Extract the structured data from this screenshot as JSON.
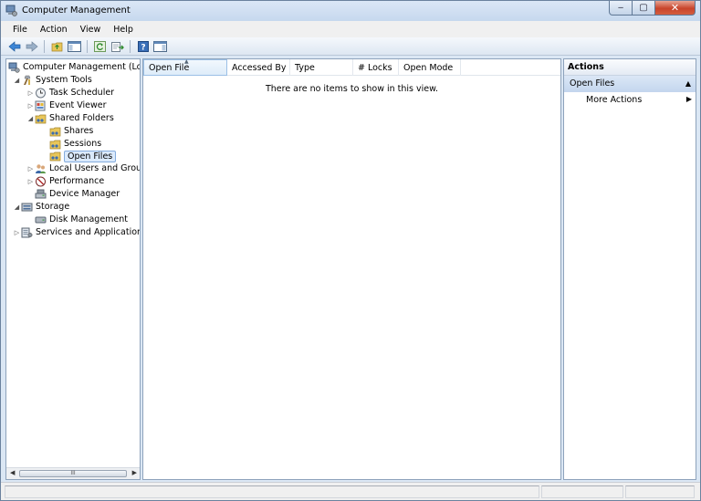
{
  "window": {
    "title": "Computer Management",
    "controls": {
      "minimize": "‒",
      "maximize": "▢",
      "close": "✕"
    }
  },
  "menu": {
    "items": [
      "File",
      "Action",
      "View",
      "Help"
    ]
  },
  "toolbar": {
    "buttons": [
      "back-arrow-icon",
      "forward-arrow-icon",
      "up-folder-icon",
      "show-hide-tree-icon",
      "refresh-icon",
      "export-list-icon",
      "help-icon",
      "show-hide-action-pane-icon"
    ]
  },
  "tree": {
    "items": [
      {
        "label": "Computer Management (Local",
        "level": 0,
        "arrow": "",
        "icon": "computer-management-icon"
      },
      {
        "label": "System Tools",
        "level": 1,
        "arrow": "◢",
        "icon": "system-tools-icon"
      },
      {
        "label": "Task Scheduler",
        "level": 2,
        "arrow": "▷",
        "icon": "clock-icon"
      },
      {
        "label": "Event Viewer",
        "level": 2,
        "arrow": "▷",
        "icon": "event-viewer-icon"
      },
      {
        "label": "Shared Folders",
        "level": 2,
        "arrow": "◢",
        "icon": "shared-folder-icon"
      },
      {
        "label": "Shares",
        "level": 3,
        "arrow": "",
        "icon": "shared-folder-icon"
      },
      {
        "label": "Sessions",
        "level": 3,
        "arrow": "",
        "icon": "shared-folder-icon"
      },
      {
        "label": "Open Files",
        "level": 3,
        "arrow": "",
        "icon": "shared-folder-icon",
        "selected": true
      },
      {
        "label": "Local Users and Groups",
        "level": 2,
        "arrow": "▷",
        "icon": "users-icon"
      },
      {
        "label": "Performance",
        "level": 2,
        "arrow": "▷",
        "icon": "performance-icon"
      },
      {
        "label": "Device Manager",
        "level": 2,
        "arrow": "",
        "icon": "device-manager-icon"
      },
      {
        "label": "Storage",
        "level": 1,
        "arrow": "◢",
        "icon": "storage-icon"
      },
      {
        "label": "Disk Management",
        "level": 2,
        "arrow": "",
        "icon": "disk-icon"
      },
      {
        "label": "Services and Applications",
        "level": 1,
        "arrow": "▷",
        "icon": "services-icon"
      }
    ],
    "scroll_thumb": "III"
  },
  "list": {
    "columns": [
      "Open File",
      "Accessed By",
      "Type",
      "# Locks",
      "Open Mode"
    ],
    "sorted_column": "Open File",
    "empty_message": "There are no items to show in this view."
  },
  "actions": {
    "title": "Actions",
    "section": "Open Files",
    "items": [
      "More Actions"
    ]
  },
  "colors": {
    "accent": "#c3d6ee",
    "selection": "#dbeafc",
    "close_button": "#c8442b"
  }
}
